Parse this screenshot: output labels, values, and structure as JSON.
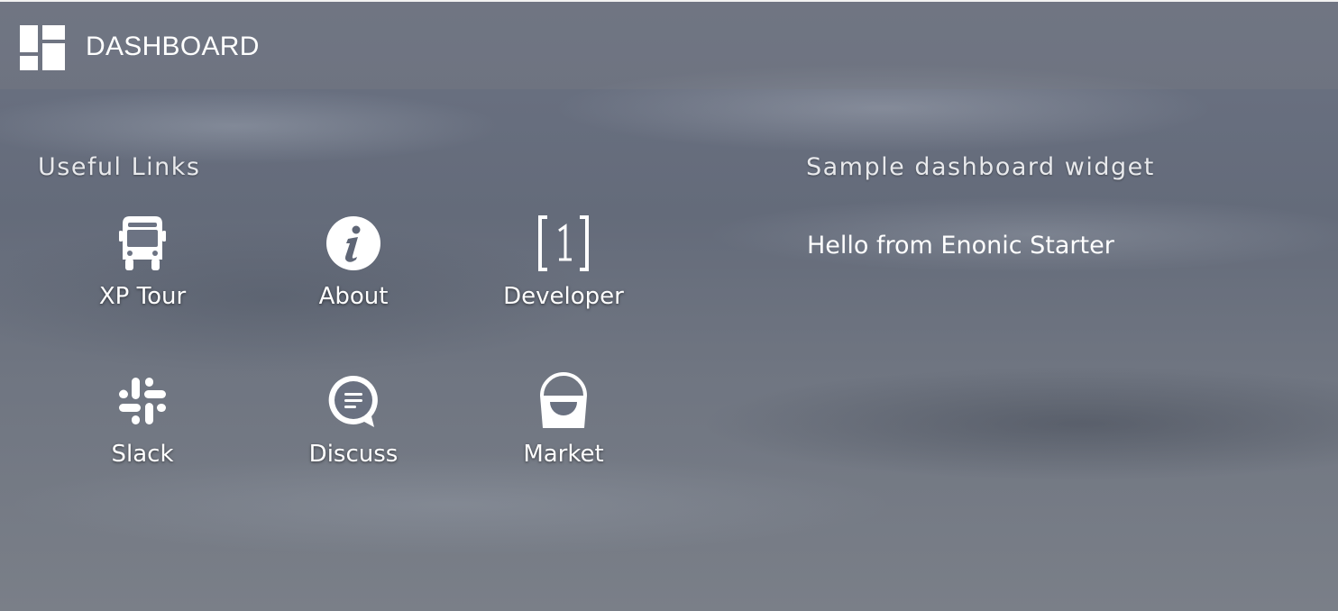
{
  "header": {
    "title": "DASHBOARD",
    "logo_icon": "dashboard-grid-icon"
  },
  "useful_links": {
    "heading": "Useful Links",
    "items": [
      {
        "label": "XP Tour",
        "icon": "bus-icon"
      },
      {
        "label": "About",
        "icon": "info-icon"
      },
      {
        "label": "Developer",
        "icon": "developer-bracket-one-icon"
      },
      {
        "label": "Slack",
        "icon": "slack-icon"
      },
      {
        "label": "Discuss",
        "icon": "discuss-bubble-icon"
      },
      {
        "label": "Market",
        "icon": "market-bag-icon"
      }
    ]
  },
  "widget": {
    "heading": "Sample dashboard widget",
    "text": "Hello from Enonic Starter"
  },
  "colors": {
    "text": "#ffffff",
    "heading_text": "#e8e9ec",
    "top_border": "#f2f2f2"
  }
}
